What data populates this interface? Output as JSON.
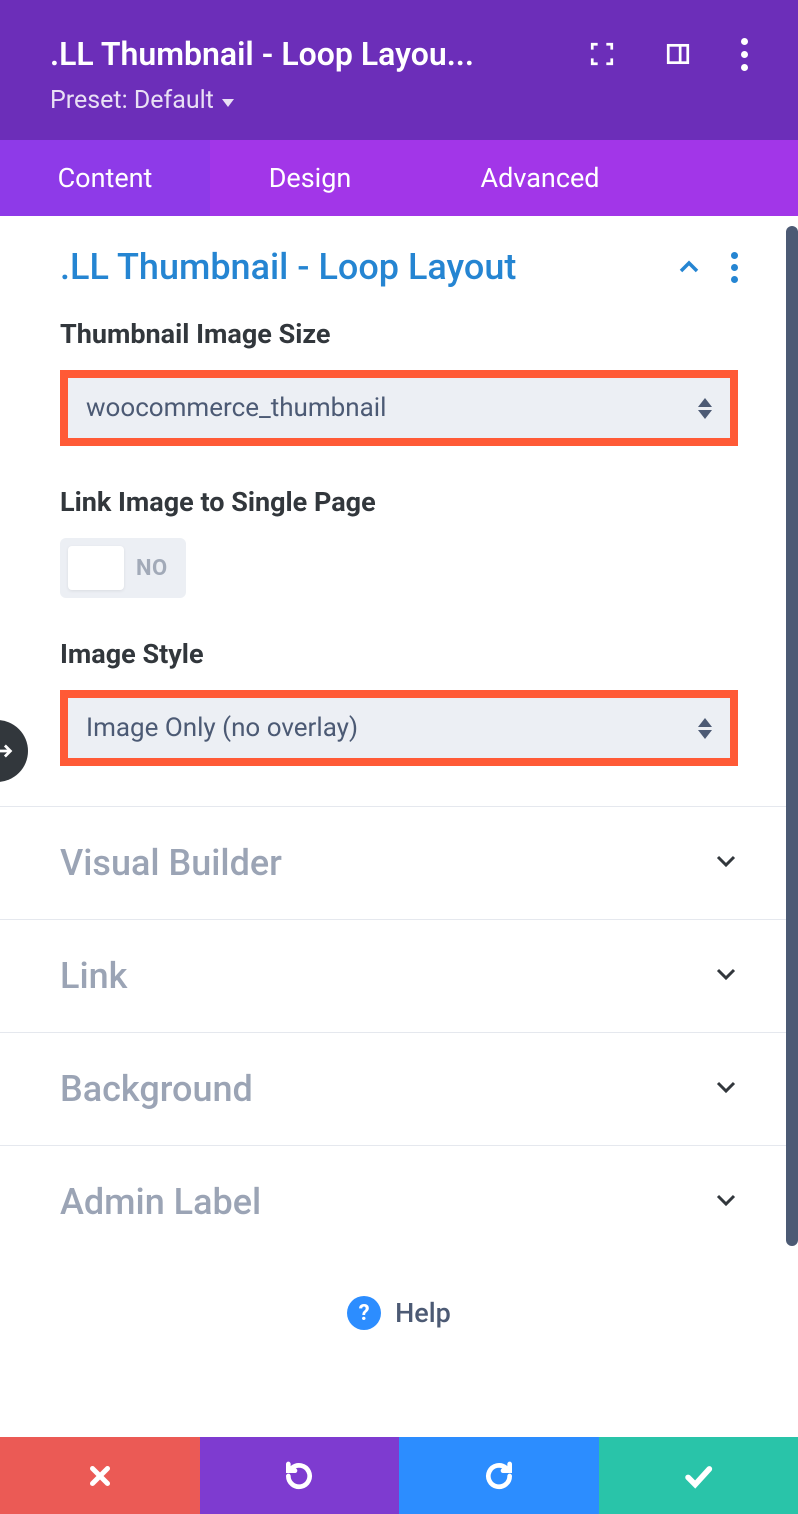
{
  "header": {
    "title": ".LL Thumbnail - Loop Layou...",
    "preset_label": "Preset: Default"
  },
  "tabs": {
    "content": "Content",
    "design": "Design",
    "advanced": "Advanced"
  },
  "main_section": {
    "title": ".LL Thumbnail - Loop Layout",
    "thumbnail_size_label": "Thumbnail Image Size",
    "thumbnail_size_value": "woocommerce_thumbnail",
    "link_image_label": "Link Image to Single Page",
    "link_image_toggle": "NO",
    "image_style_label": "Image Style",
    "image_style_value": "Image Only (no overlay)"
  },
  "collapsed": {
    "visual_builder": "Visual Builder",
    "link": "Link",
    "background": "Background",
    "admin_label": "Admin Label"
  },
  "footer": {
    "help": "Help"
  }
}
